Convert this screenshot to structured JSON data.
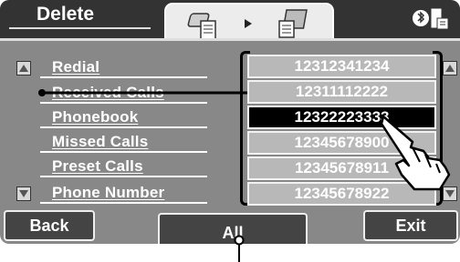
{
  "header": {
    "title": "Delete"
  },
  "menu": {
    "items": [
      "Redial",
      "Received Calls",
      "Phonebook",
      "Missed Calls",
      "Preset Calls",
      "Phone Number"
    ]
  },
  "numbers": [
    "12312341234",
    "12311112222",
    "12322223333",
    "12345678900",
    "12345678911",
    "12345678922"
  ],
  "buttons": {
    "back": "Back",
    "all": "All",
    "exit": "Exit"
  }
}
